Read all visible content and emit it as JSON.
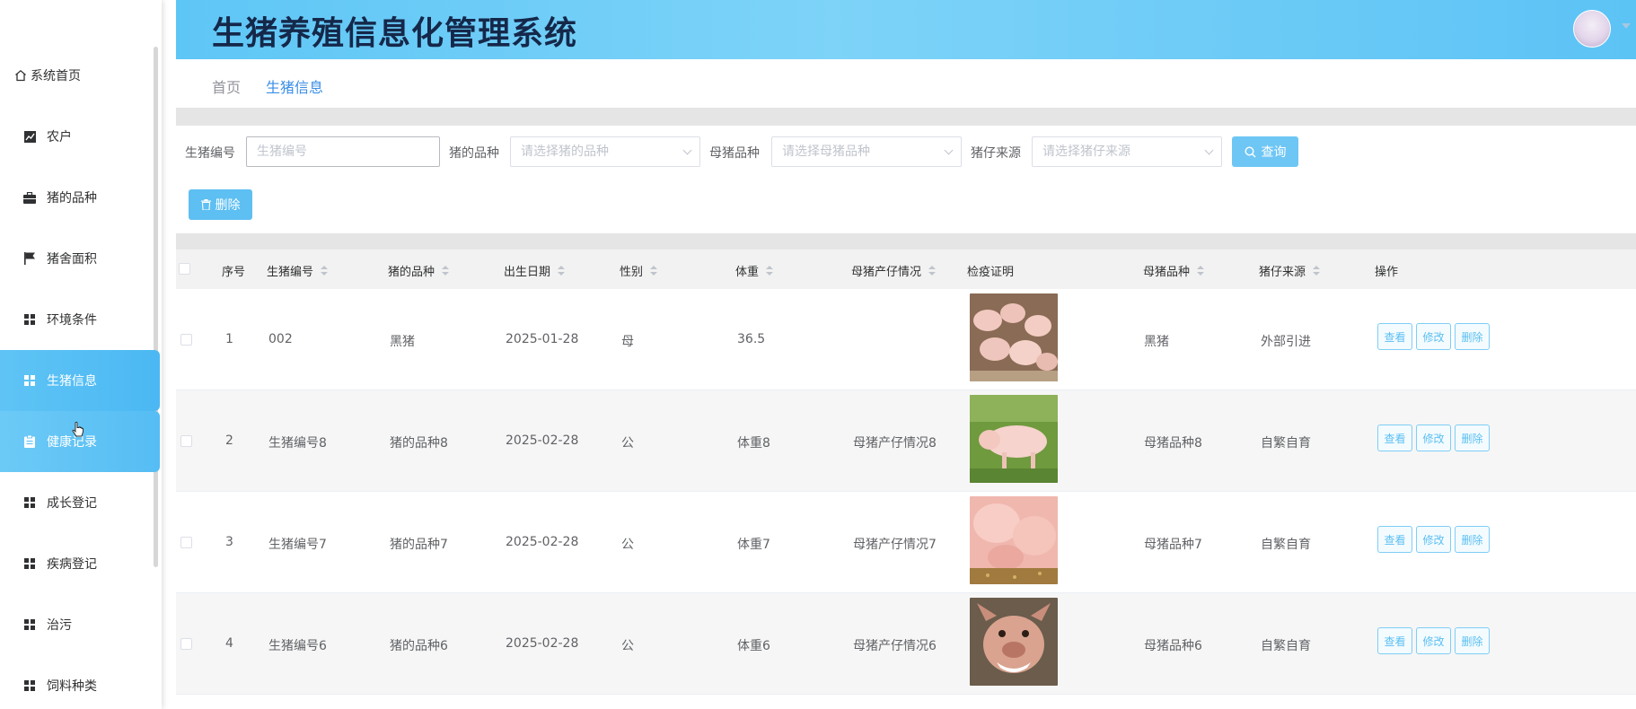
{
  "app": {
    "title": "生猪养殖信息化管理系统"
  },
  "sidebar": {
    "items": [
      {
        "label": "系统首页",
        "icon": "home-icon"
      },
      {
        "label": "农户",
        "icon": "chart-icon"
      },
      {
        "label": "猪的品种",
        "icon": "briefcase-icon"
      },
      {
        "label": "猪舍面积",
        "icon": "flag-icon"
      },
      {
        "label": "环境条件",
        "icon": "grid-icon"
      },
      {
        "label": "生猪信息",
        "icon": "grid-icon",
        "active": true
      },
      {
        "label": "健康记录",
        "icon": "clipboard-icon",
        "hover": true
      },
      {
        "label": "成长登记",
        "icon": "grid-icon"
      },
      {
        "label": "疾病登记",
        "icon": "grid-icon"
      },
      {
        "label": "治污",
        "icon": "grid-icon"
      },
      {
        "label": "饲料种类",
        "icon": "grid-icon"
      }
    ]
  },
  "breadcrumb": {
    "home": "首页",
    "current": "生猪信息"
  },
  "search": {
    "pig_no_label": "生猪编号",
    "pig_no_placeholder": "生猪编号",
    "breed_label": "猪的品种",
    "breed_placeholder": "请选择猪的品种",
    "sow_breed_label": "母猪品种",
    "sow_breed_placeholder": "请选择母猪品种",
    "source_label": "猪仔来源",
    "source_placeholder": "请选择猪仔来源",
    "query_label": "查询",
    "delete_label": "删除"
  },
  "table": {
    "headers": [
      "序号",
      "生猪编号",
      "猪的品种",
      "出生日期",
      "性别",
      "体重",
      "母猪产仔情况",
      "检疫证明",
      "母猪品种",
      "猪仔来源",
      "操作"
    ],
    "actions": {
      "view": "查看",
      "edit": "修改",
      "delete": "删除"
    },
    "rows": [
      {
        "index": "1",
        "pig_no": "002",
        "breed": "黑猪",
        "birth": "2025-01-28",
        "sex": "母",
        "weight": "36.5",
        "sow_status": "",
        "sow_breed": "黑猪",
        "source": "外部引进"
      },
      {
        "index": "2",
        "pig_no": "生猪编号8",
        "breed": "猪的品种8",
        "birth": "2025-02-28",
        "sex": "公",
        "weight": "体重8",
        "sow_status": "母猪产仔情况8",
        "sow_breed": "母猪品种8",
        "source": "自繁自育"
      },
      {
        "index": "3",
        "pig_no": "生猪编号7",
        "breed": "猪的品种7",
        "birth": "2025-02-28",
        "sex": "公",
        "weight": "体重7",
        "sow_status": "母猪产仔情况7",
        "sow_breed": "母猪品种7",
        "source": "自繁自育"
      },
      {
        "index": "4",
        "pig_no": "生猪编号6",
        "breed": "猪的品种6",
        "birth": "2025-02-28",
        "sex": "公",
        "weight": "体重6",
        "sow_status": "母猪产仔情况6",
        "sow_breed": "母猪品种6",
        "source": "自繁自育"
      }
    ]
  },
  "colors": {
    "accent": "#5ebff2",
    "header_gradient_start": "#5ec6f6",
    "title": "#15284a"
  }
}
